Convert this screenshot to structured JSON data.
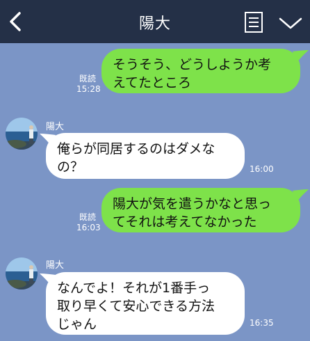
{
  "header": {
    "title": "陽大"
  },
  "messages": [
    {
      "side": "me",
      "lines": [
        "そうそう、どうしようか考",
        "えてたところ"
      ],
      "read": "既読",
      "time": "15:28"
    },
    {
      "side": "other",
      "sender": "陽大",
      "lines": [
        "俺らが同居するのはダメな",
        "の？"
      ],
      "time": "16:00"
    },
    {
      "side": "me",
      "lines": [
        "陽大が気を遣うかなと思っ",
        "てそれは考えてなかった"
      ],
      "read": "既読",
      "time": "16:03"
    },
    {
      "side": "other",
      "sender": "陽大",
      "lines": [
        "なんでよ！それが1番手っ",
        "取り早くて安心できる方法",
        "じゃん"
      ],
      "time": "16:35"
    }
  ],
  "colors": {
    "background": "#7b95c6",
    "header": "#243047",
    "my_bubble": "#7ee24a",
    "other_bubble": "#ffffff"
  },
  "icons": [
    "back-arrow-icon",
    "memo-icon",
    "chevron-down-icon"
  ]
}
